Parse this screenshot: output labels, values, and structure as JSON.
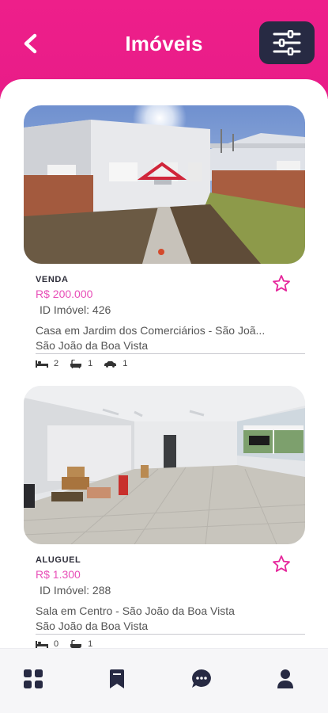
{
  "header": {
    "title": "Imóveis",
    "back_icon": "chevron-left-icon",
    "filter_icon": "sliders-icon",
    "gradient": [
      "#ee1f8a",
      "#e81c88"
    ]
  },
  "listings": [
    {
      "deal": "VENDA",
      "price": "R$ 200.000",
      "id_label": "ID Imóvel: 426",
      "description": "Casa em Jardim dos Comerciários - São Joã...",
      "city": "São João da Boa Vista",
      "bedrooms": "2",
      "bathrooms": "1",
      "garages": "1"
    },
    {
      "deal": "ALUGUEL",
      "price": "R$ 1.300",
      "id_label": "ID Imóvel: 288",
      "description": "Sala em Centro - São João da Boa Vista",
      "city": "São João da Boa Vista",
      "bedrooms": "0",
      "bathrooms": "1"
    }
  ],
  "nav": {
    "items": [
      "grid-icon",
      "bookmark-icon",
      "chat-icon",
      "user-icon"
    ]
  },
  "colors": {
    "accent": "#e81c88",
    "price": "#e84fb8",
    "dark": "#272a43"
  }
}
